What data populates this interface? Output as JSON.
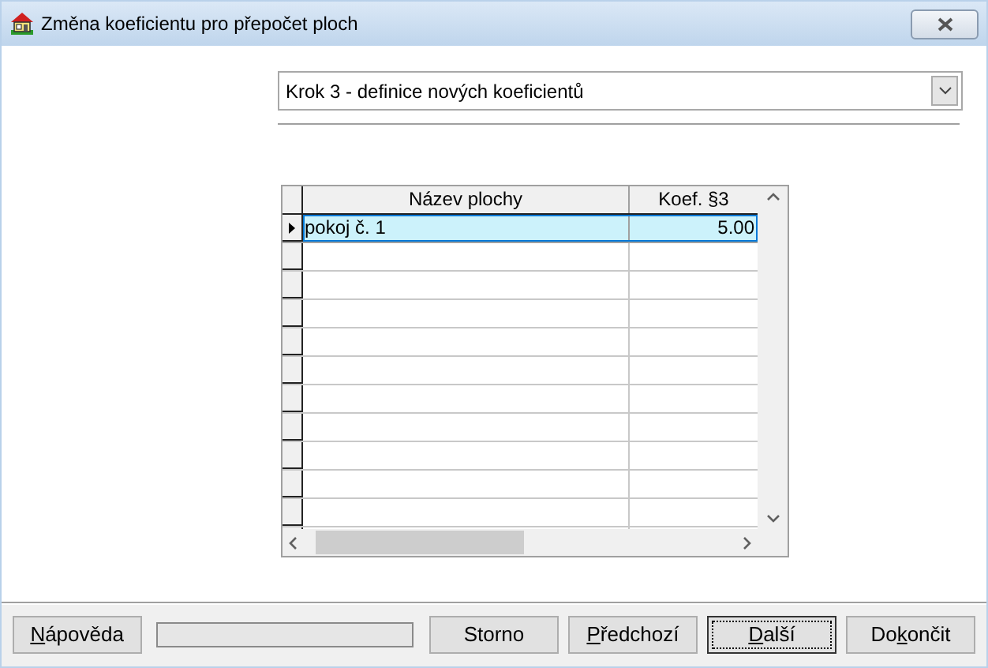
{
  "window": {
    "title": "Změna koeficientu pro přepočet ploch"
  },
  "step_select": {
    "value": "Krok 3 - definice nových koeficientů"
  },
  "table": {
    "columns": [
      "Název plochy",
      "Koef. §3"
    ],
    "rows": [
      {
        "cells": [
          "pokoj č. 1",
          "5.00"
        ],
        "selected": true
      }
    ]
  },
  "buttons": [
    {
      "key": "N",
      "post": "ápověda",
      "default": false
    },
    {
      "label": "Storno",
      "default": false
    },
    {
      "key": "P",
      "post": "ředchozí",
      "default": false
    },
    {
      "key": "D",
      "post": "alší",
      "default": true
    },
    {
      "pre": "Do",
      "key": "k",
      "post": "ončit",
      "default": false
    }
  ]
}
